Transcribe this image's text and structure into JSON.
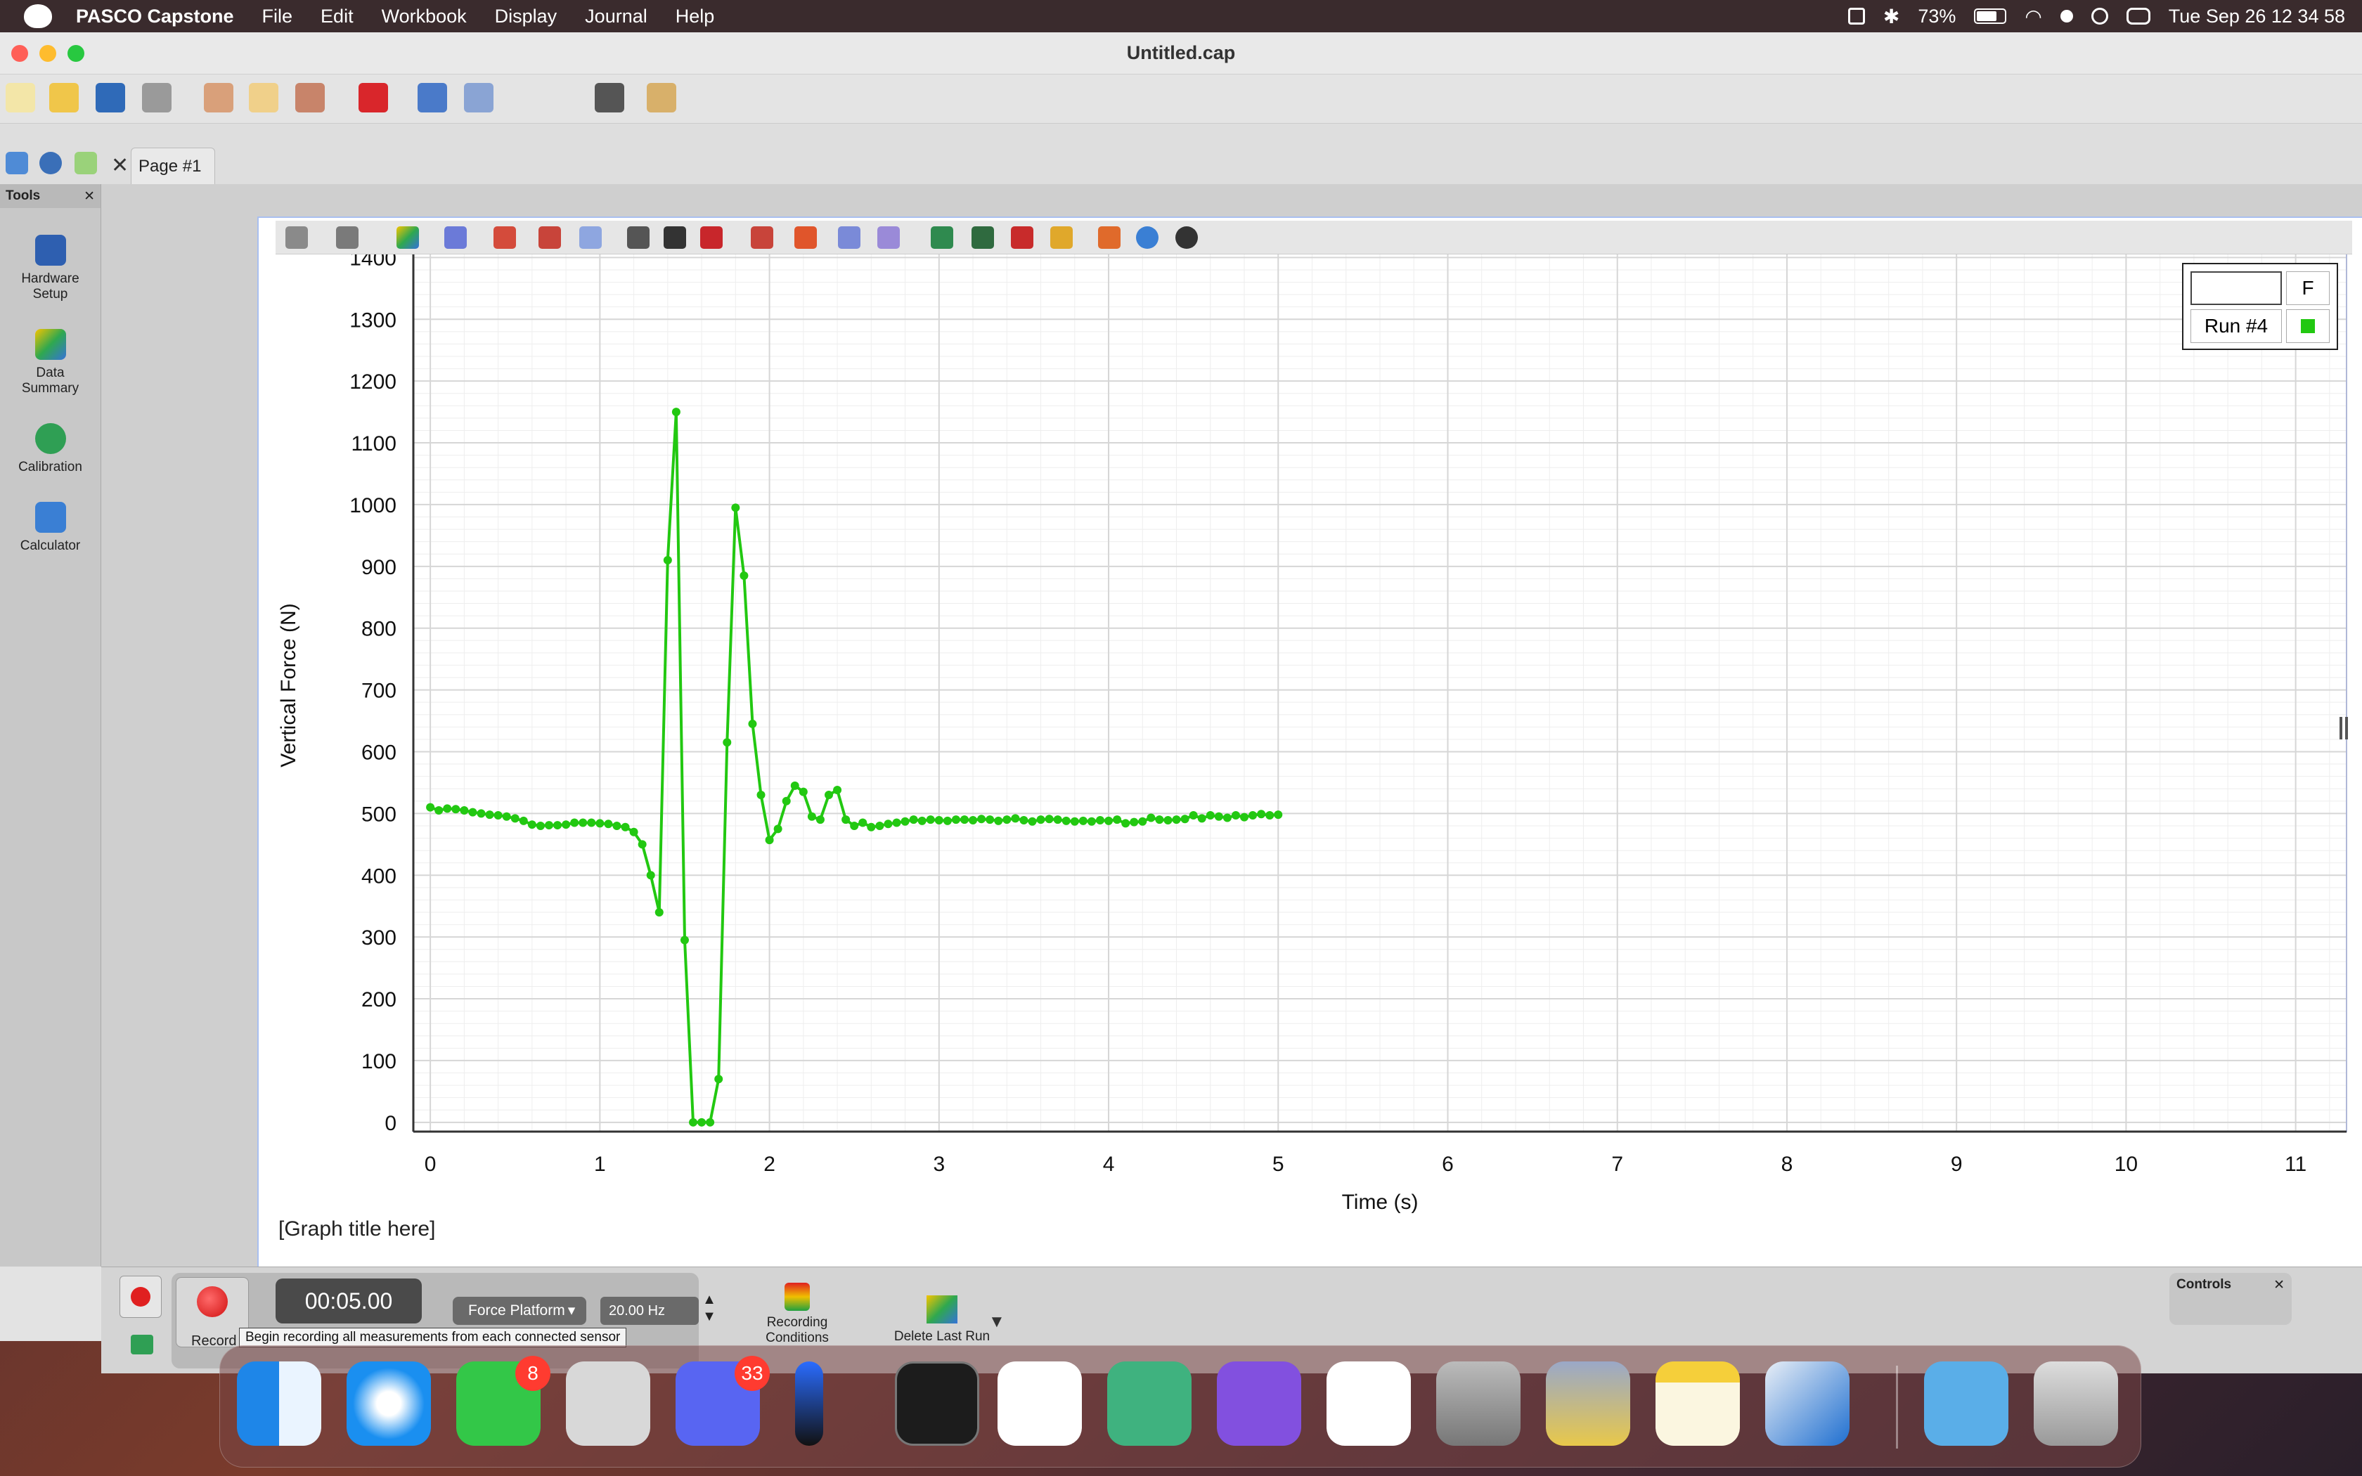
{
  "menubar": {
    "app_name": "PASCO Capstone",
    "items": [
      "File",
      "Edit",
      "Workbook",
      "Display",
      "Journal",
      "Help"
    ],
    "battery": "73%",
    "datetime": "Tue Sep 26  12 34 58"
  },
  "window": {
    "title": "Untitled.cap"
  },
  "tabs": {
    "page": "Page #1"
  },
  "sidebar": {
    "title": "Tools",
    "items": [
      {
        "label_1": "Hardware",
        "label_2": "Setup",
        "icon": "hardware-setup-icon"
      },
      {
        "label_1": "Data",
        "label_2": "Summary",
        "icon": "data-summary-icon"
      },
      {
        "label_1": "Calibration",
        "label_2": "",
        "icon": "calibration-icon"
      },
      {
        "label_1": "Calculator",
        "label_2": "",
        "icon": "calculator-icon"
      }
    ]
  },
  "graph": {
    "title_placeholder": "[Graph title here]",
    "legend": {
      "header": "F",
      "run": "Run #4",
      "color": "#22c811"
    }
  },
  "chart_data": {
    "type": "line",
    "xlabel": "Time (s)",
    "ylabel": "Vertical Force (N)",
    "xlim": [
      -0.1,
      11.3
    ],
    "ylim": [
      -15,
      1430
    ],
    "xticks": [
      0,
      1,
      2,
      3,
      4,
      5,
      6,
      7,
      8,
      9,
      10,
      11
    ],
    "yticks": [
      0,
      100,
      200,
      300,
      400,
      500,
      600,
      700,
      800,
      900,
      1000,
      1100,
      1200,
      1300,
      1400
    ],
    "grid": true,
    "legend_position": "top-right",
    "series": [
      {
        "name": "Run #4",
        "color": "#22c811",
        "x": [
          0,
          0.05,
          0.1,
          0.15,
          0.2,
          0.25,
          0.3,
          0.35,
          0.4,
          0.45,
          0.5,
          0.55,
          0.6,
          0.65,
          0.7,
          0.75,
          0.8,
          0.85,
          0.9,
          0.95,
          1.0,
          1.05,
          1.1,
          1.15,
          1.2,
          1.25,
          1.3,
          1.35,
          1.4,
          1.45,
          1.5,
          1.55,
          1.6,
          1.65,
          1.7,
          1.75,
          1.8,
          1.85,
          1.9,
          1.95,
          2.0,
          2.05,
          2.1,
          2.15,
          2.2,
          2.25,
          2.3,
          2.35,
          2.4,
          2.45,
          2.5,
          2.55,
          2.6,
          2.65,
          2.7,
          2.75,
          2.8,
          2.85,
          2.9,
          2.95,
          3.0,
          3.05,
          3.1,
          3.15,
          3.2,
          3.25,
          3.3,
          3.35,
          3.4,
          3.45,
          3.5,
          3.55,
          3.6,
          3.65,
          3.7,
          3.75,
          3.8,
          3.85,
          3.9,
          3.95,
          4.0,
          4.05,
          4.1,
          4.15,
          4.2,
          4.25,
          4.3,
          4.35,
          4.4,
          4.45,
          4.5,
          4.55,
          4.6,
          4.65,
          4.7,
          4.75,
          4.8,
          4.85,
          4.9,
          4.95,
          5.0
        ],
        "y": [
          510,
          505,
          508,
          507,
          505,
          502,
          500,
          498,
          497,
          495,
          492,
          488,
          482,
          480,
          481,
          481,
          482,
          485,
          485,
          485,
          484,
          483,
          480,
          478,
          470,
          450,
          400,
          340,
          910,
          1150,
          295,
          0,
          0,
          0,
          70,
          615,
          995,
          885,
          645,
          530,
          457,
          475,
          520,
          545,
          535,
          495,
          490,
          530,
          538,
          490,
          480,
          485,
          478,
          480,
          483,
          485,
          487,
          490,
          488,
          490,
          489,
          488,
          490,
          490,
          489,
          491,
          490,
          488,
          490,
          492,
          489,
          487,
          490,
          491,
          490,
          488,
          487,
          488,
          487,
          489,
          488,
          490,
          484,
          486,
          487,
          493,
          490,
          489,
          490,
          491,
          497,
          492,
          497,
          495,
          493,
          497,
          494,
          497,
          499,
          497,
          498
        ]
      }
    ]
  },
  "controls": {
    "title": "Controls",
    "record_label": "Record",
    "timer": "00:05.00",
    "sensor": "Force Platform",
    "rate": "20.00 Hz",
    "recording_conditions_1": "Recording",
    "recording_conditions_2": "Conditions",
    "delete_last_run": "Delete Last Run",
    "tooltip": "Begin recording all measurements from each connected sensor"
  },
  "dock": {
    "badges": {
      "messages": "8",
      "discord": "33"
    }
  }
}
